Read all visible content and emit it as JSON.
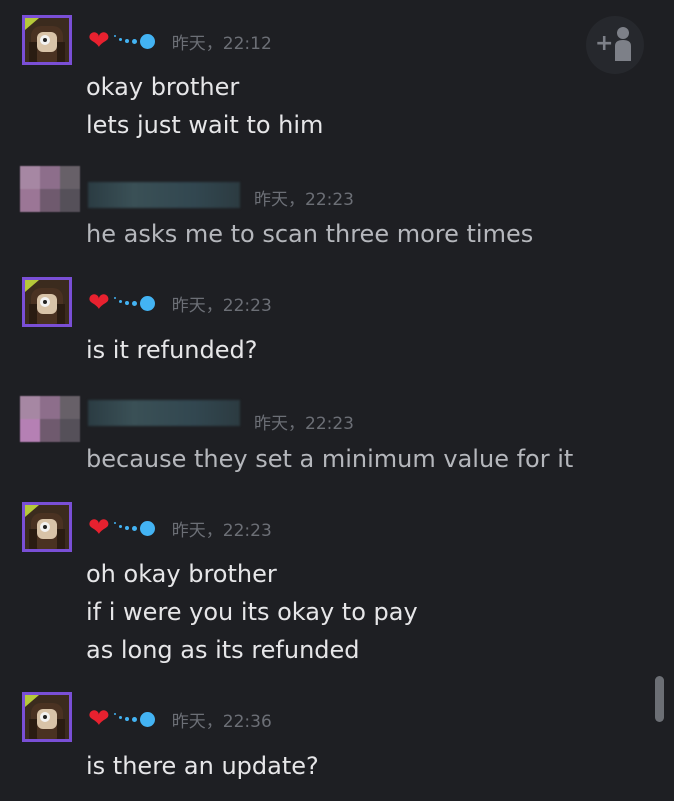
{
  "conversation": {
    "messages": [
      {
        "sender": "self",
        "timestamp": "昨天，22:12",
        "lines": [
          "okay brother",
          "lets just wait to him"
        ]
      },
      {
        "sender": "other",
        "timestamp": "昨天，22:23",
        "lines": [
          "he asks me to scan three more times"
        ]
      },
      {
        "sender": "self",
        "timestamp": "昨天，22:23",
        "lines": [
          "is it refunded?"
        ]
      },
      {
        "sender": "other",
        "timestamp": "昨天，22:23",
        "lines": [
          "because they set a minimum value for it"
        ]
      },
      {
        "sender": "self",
        "timestamp": "昨天，22:23",
        "lines": [
          "oh okay brother",
          "if i were you its okay to pay",
          "as long as its refunded"
        ]
      },
      {
        "sender": "self",
        "timestamp": "昨天，22:36",
        "lines": [
          "is there an update?"
        ]
      }
    ]
  },
  "icons": {
    "self_name": [
      "heart-icon",
      "dots-icon"
    ],
    "add_friend": "add-friend-icon"
  },
  "colors": {
    "background": "#1e1f23",
    "self_text": "#e6e6e8",
    "other_text": "#b5b7bc",
    "timestamp": "#6c6f76",
    "heart": "#e8212f",
    "dots": "#43b3f3",
    "avatar_border": "#7a4fd6"
  }
}
